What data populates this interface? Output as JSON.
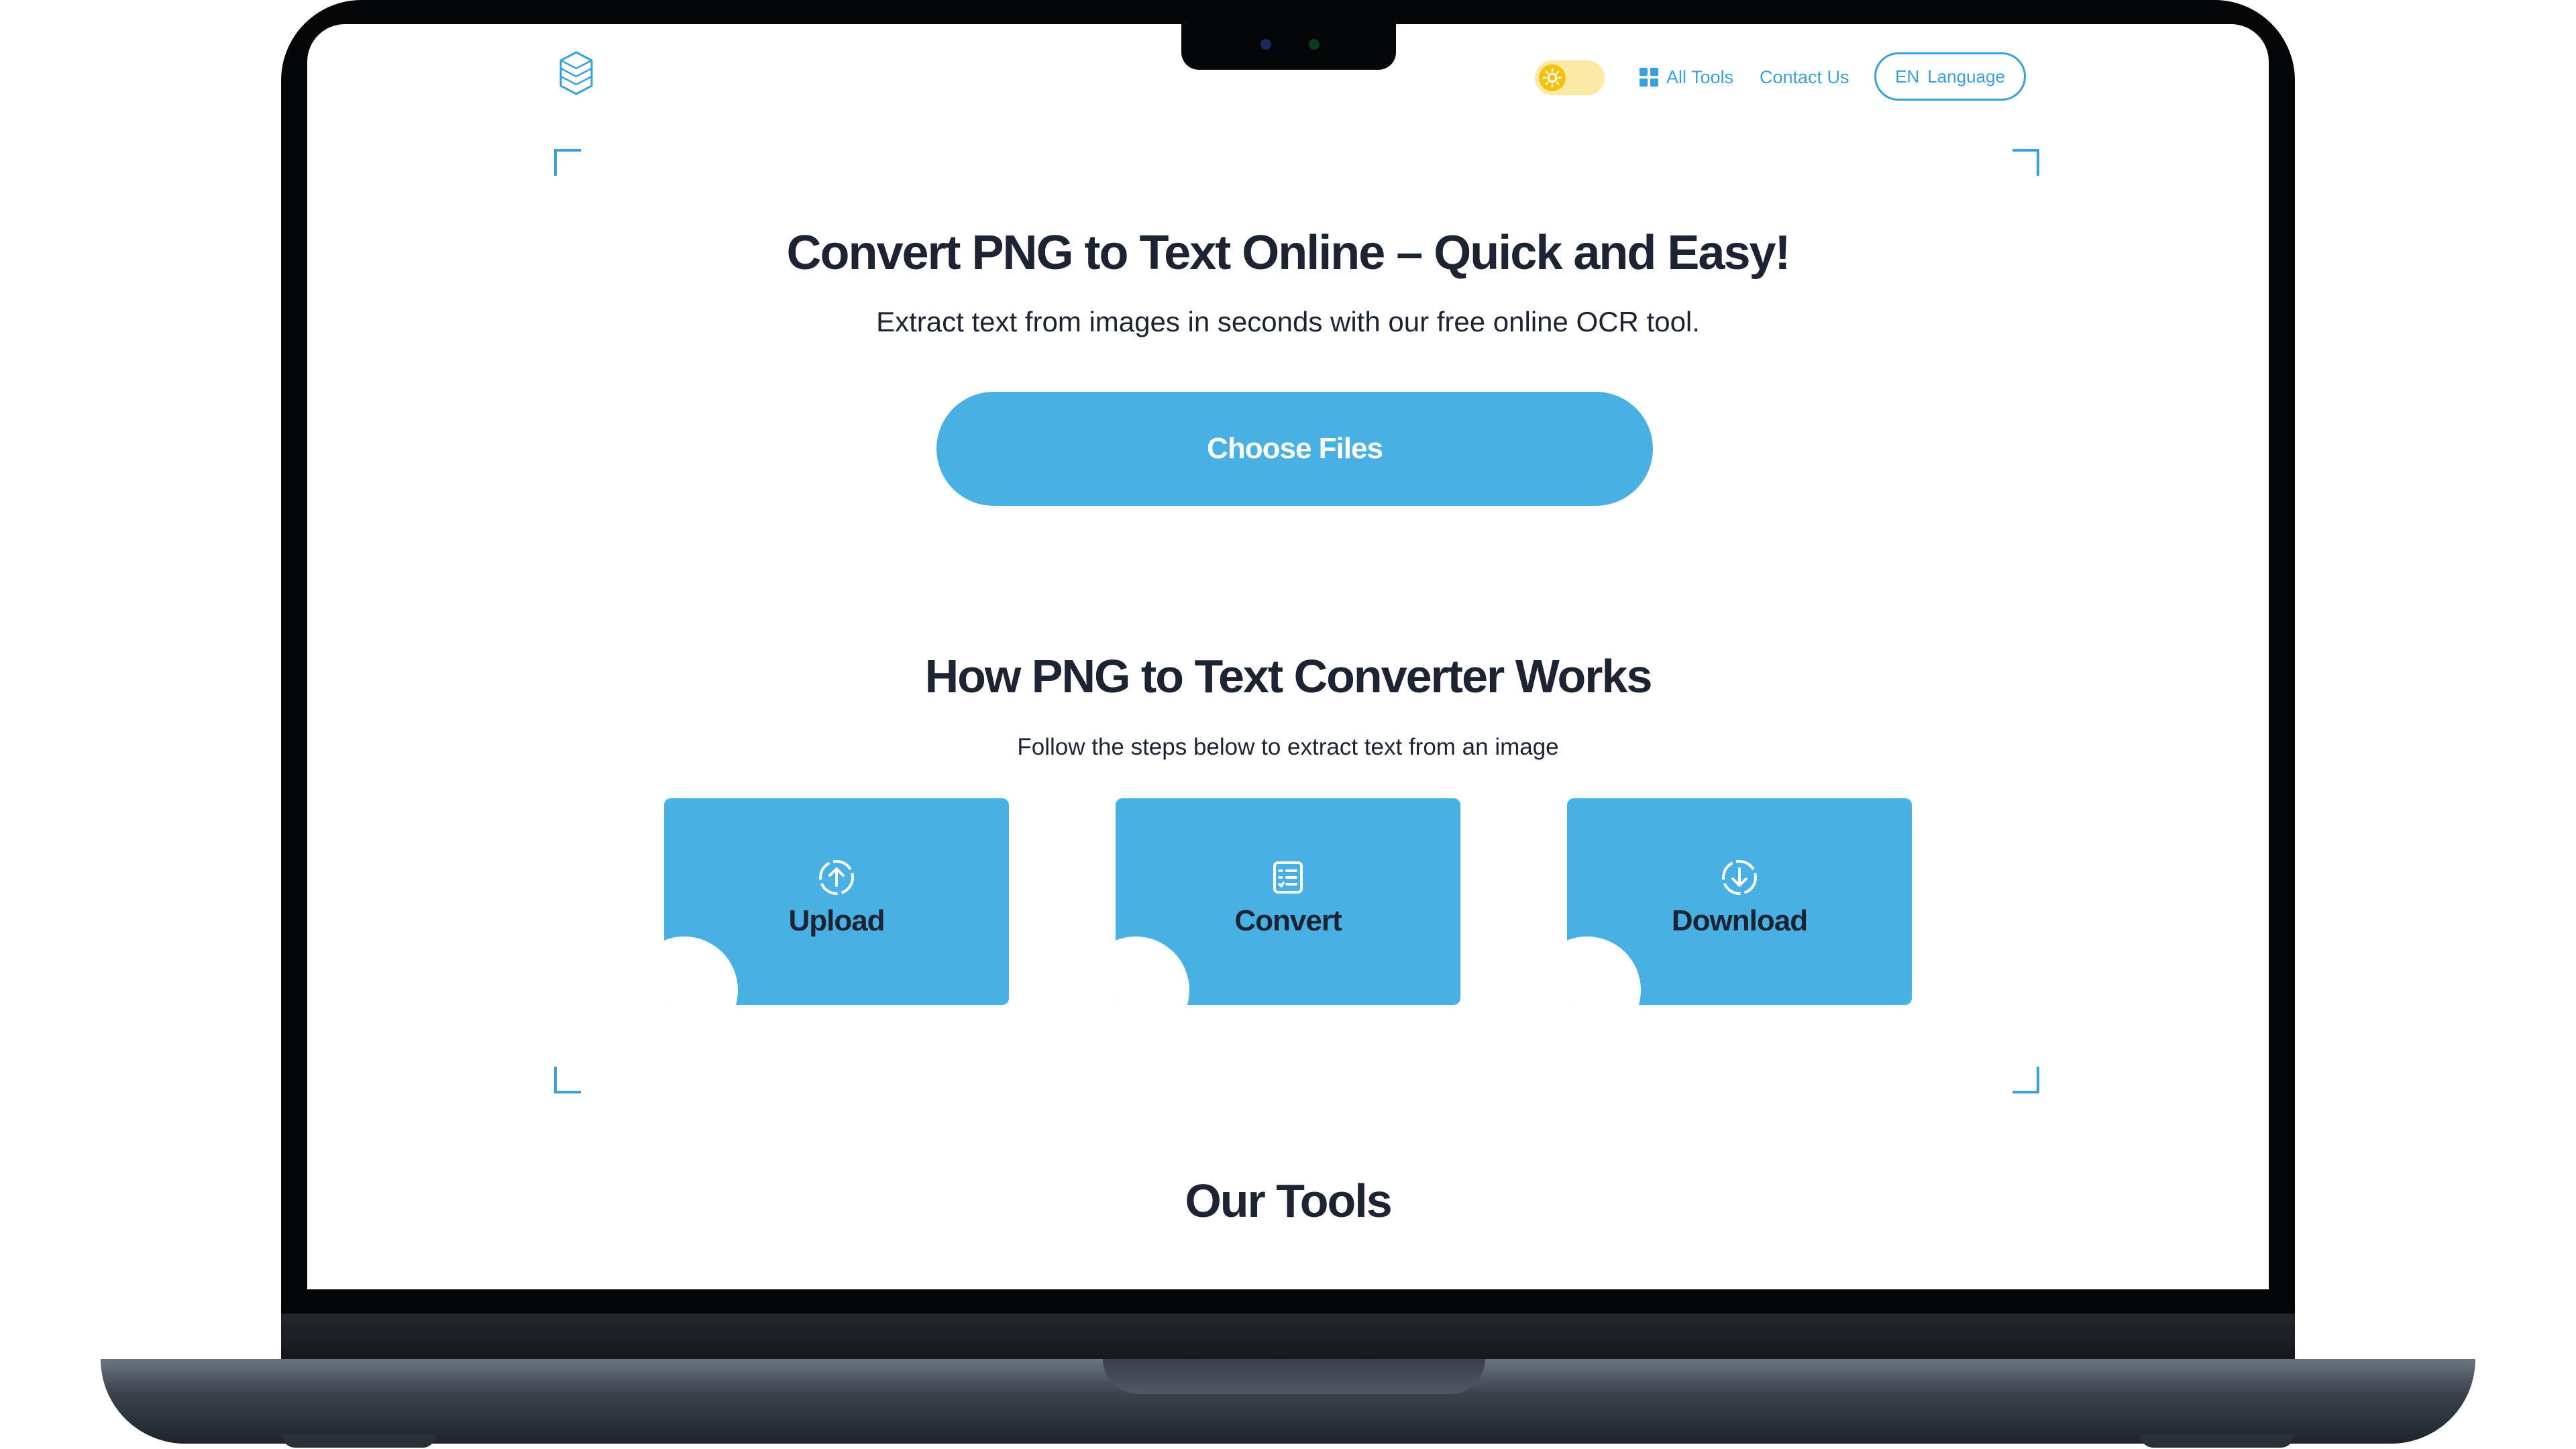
{
  "header": {
    "all_tools_label": "All Tools",
    "contact_label": "Contact Us",
    "language": {
      "code": "EN",
      "label": "Language"
    },
    "theme_toggle": "light"
  },
  "hero": {
    "title": "Convert PNG to Text Online – Quick and Easy!",
    "subtitle": "Extract text from images in seconds with our free online OCR tool.",
    "choose_files_label": "Choose Files"
  },
  "how_it_works": {
    "title": "How PNG to Text Converter Works",
    "subtitle": "Follow the steps below to extract text from an image",
    "steps": [
      {
        "label": "Upload",
        "icon": "upload-circle-icon"
      },
      {
        "label": "Convert",
        "icon": "document-convert-icon"
      },
      {
        "label": "Download",
        "icon": "download-circle-icon"
      }
    ]
  },
  "tools": {
    "title": "Our Tools"
  },
  "colors": {
    "accent": "#48b0e2",
    "link": "#3aa0dc",
    "heading": "#1c2433",
    "toggle_track": "#fbe9a5",
    "toggle_knob": "#f4c20d"
  }
}
